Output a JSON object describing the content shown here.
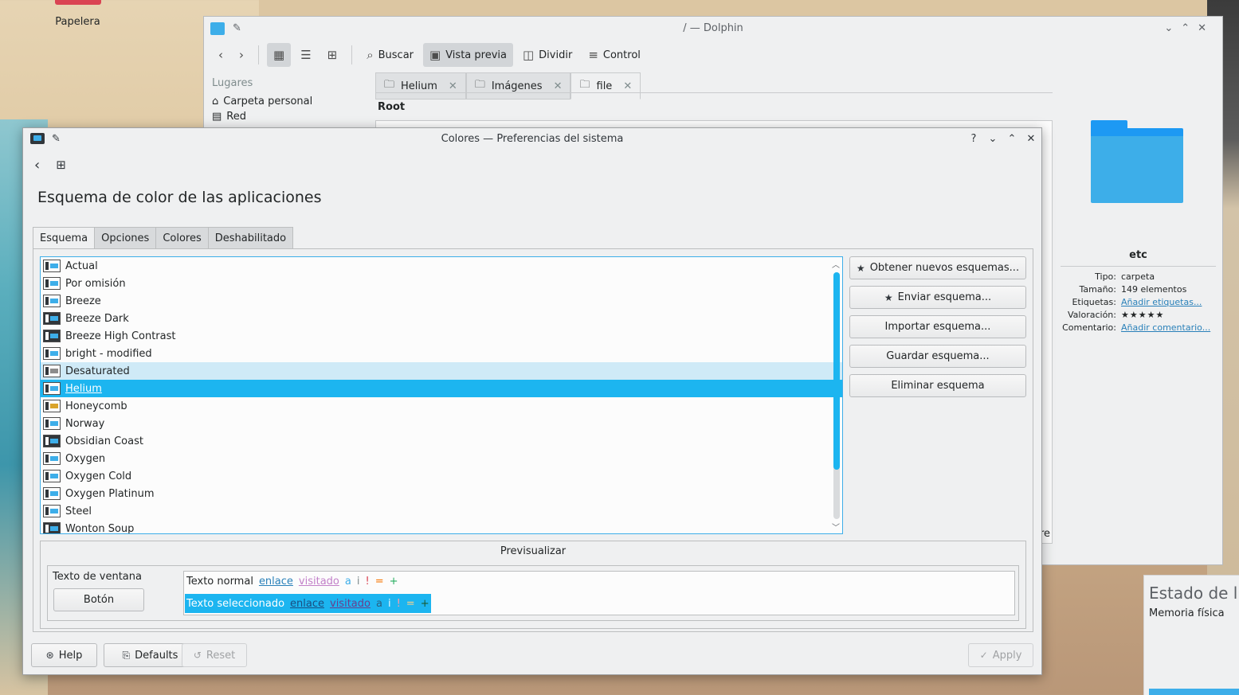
{
  "desktop": {
    "trash_label": "Papelera"
  },
  "dolphin": {
    "title": "/ — Dolphin",
    "toolbar": {
      "search": "Buscar",
      "preview": "Vista previa",
      "split": "Dividir",
      "control": "Control"
    },
    "places": {
      "title": "Lugares",
      "items": [
        "Carpeta personal",
        "Red"
      ]
    },
    "tabs": [
      "Helium",
      "Imágenes",
      "file"
    ],
    "breadcrumb": "Root",
    "partial_text": "re",
    "info": {
      "name": "etc",
      "rows": [
        {
          "label": "Tipo:",
          "value": "carpeta"
        },
        {
          "label": "Tamaño:",
          "value": "149 elementos"
        },
        {
          "label": "Etiquetas:",
          "value": "Añadir etiquetas..."
        },
        {
          "label": "Valoración:",
          "value": "★★★★★"
        },
        {
          "label": "Comentario:",
          "value": "Añadir comentario..."
        }
      ]
    }
  },
  "widget": {
    "title": "Estado de l",
    "subtitle": "Memoria física"
  },
  "dialog": {
    "title": "Colores  — Preferencias del sistema",
    "page_title": "Esquema de color de las aplicaciones",
    "tabs": [
      "Esquema",
      "Opciones",
      "Colores",
      "Deshabilitado"
    ],
    "schemes": [
      {
        "label": "Actual",
        "style": "light",
        "state": ""
      },
      {
        "label": "Por omisión",
        "style": "light",
        "state": ""
      },
      {
        "label": "Breeze",
        "style": "light",
        "state": ""
      },
      {
        "label": "Breeze Dark",
        "style": "dark",
        "state": ""
      },
      {
        "label": "Breeze High Contrast",
        "style": "dark",
        "state": ""
      },
      {
        "label": "bright - modified",
        "style": "light",
        "state": ""
      },
      {
        "label": "Desaturated",
        "style": "gray",
        "state": "hover"
      },
      {
        "label": "Helium",
        "style": "light",
        "state": "selected"
      },
      {
        "label": "Honeycomb",
        "style": "gold",
        "state": ""
      },
      {
        "label": "Norway",
        "style": "light",
        "state": ""
      },
      {
        "label": "Obsidian Coast",
        "style": "dark",
        "state": ""
      },
      {
        "label": "Oxygen",
        "style": "light",
        "state": ""
      },
      {
        "label": "Oxygen Cold",
        "style": "light",
        "state": ""
      },
      {
        "label": "Oxygen Platinum",
        "style": "light",
        "state": ""
      },
      {
        "label": "Steel",
        "style": "light",
        "state": ""
      },
      {
        "label": "Wonton Soup",
        "style": "dark",
        "state": ""
      }
    ],
    "scroll_position": 0.8,
    "side_buttons": {
      "get_new": "Obtener nuevos esquemas...",
      "upload": "Enviar esquema...",
      "import": "Importar esquema...",
      "save": "Guardar esquema...",
      "remove": "Eliminar esquema"
    },
    "preview": {
      "title": "Previsualizar",
      "window_text": "Texto de ventana",
      "button": "Botón",
      "normal_text": "Texto normal",
      "selected_text": "Texto seleccionado",
      "link": "enlace",
      "visited": "visitado",
      "active": "a",
      "inactive": "i",
      "negative": "!",
      "neutral": "=",
      "positive": "+"
    },
    "footer": {
      "help": "Help",
      "defaults": "Defaults",
      "reset": "Reset",
      "apply": "Apply"
    }
  },
  "colors": {
    "accent": "#3daee9",
    "selection": "#1cb5f0",
    "hover": "#cfeaf7",
    "window_bg": "#eff0f1",
    "view_bg": "#fcfcfc",
    "link": "#2980b9",
    "visited": "#c280c9",
    "negative": "#da4453",
    "neutral": "#f67400",
    "positive": "#27ae60"
  }
}
